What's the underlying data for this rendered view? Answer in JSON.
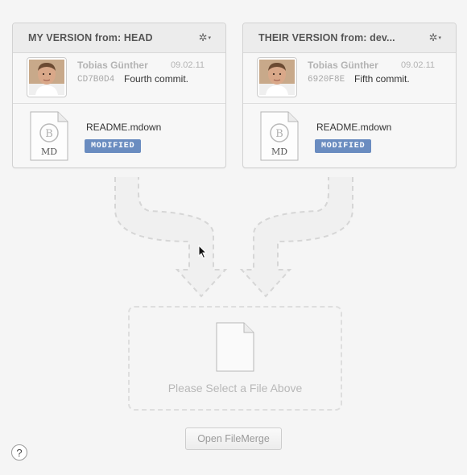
{
  "mine": {
    "title": "MY VERSION from: HEAD",
    "author": "Tobias Günther",
    "date": "09.02.11",
    "hash": "CD7B0D4",
    "message": "Fourth commit.",
    "file_name": "README.mdown",
    "status": "MODIFIED",
    "file_icon_letter": "B",
    "file_icon_ext": "MD"
  },
  "theirs": {
    "title": "THEIR VERSION from: dev...",
    "author": "Tobias Günther",
    "date": "09.02.11",
    "hash": "6920F8E",
    "message": "Fifth commit.",
    "file_name": "README.mdown",
    "status": "MODIFIED",
    "file_icon_letter": "B",
    "file_icon_ext": "MD"
  },
  "result": {
    "placeholder": "Please Select a File Above"
  },
  "actions": {
    "open_filemerge": "Open FileMerge",
    "help": "?"
  },
  "colors": {
    "badge": "#6a8cc0",
    "background": "#f5f5f5"
  }
}
